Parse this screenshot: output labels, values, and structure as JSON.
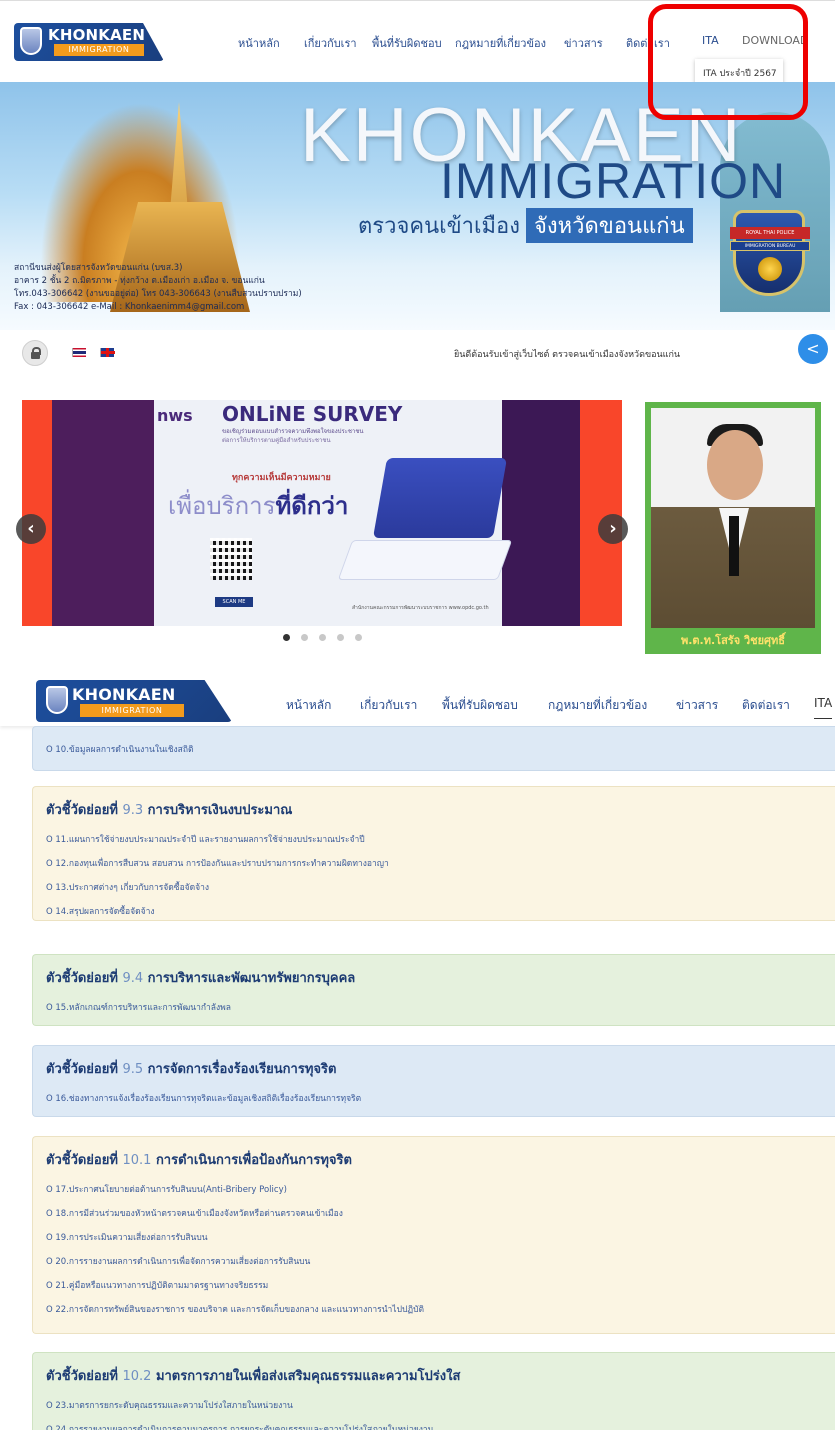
{
  "site": {
    "logo_title": "KHONKAEN",
    "logo_sub": "IMMIGRATION"
  },
  "nav": {
    "items": [
      "หน้าหลัก",
      "เกี่ยวกับเรา",
      "พื้นที่รับผิดชอบ",
      "กฎหมายที่เกี่ยวข้อง",
      "ข่าวสาร",
      "ติดต่อเรา",
      "ITA",
      "DOWNLOAD"
    ],
    "ita_dropdown_item": "ITA ประจำปี 2567"
  },
  "banner": {
    "headline_1": "KHONKAEN",
    "headline_2": "IMMIGRATION",
    "thai_line_a": "ตรวจคนเข้าเมือง",
    "thai_line_b": "จังหวัดขอนแก่น",
    "address": [
      "สถานีขนส่งผู้โดยสารจังหวัดขอนแก่น (บขส.3)",
      "อาคาร 2 ชั้น 2 ถ.มิตรภาพ - ทุ่งกว้าง ต.เมืองเก่า อ.เมือง จ. ขอนแก่น",
      "โทร.043-306642 (งานขออยู่ต่อ) โทร 043-306643 (งานสืบสวนปราบปราม)",
      "Fax : 043-306642 e-Mail : Khonkaenimm4@gmail.com"
    ],
    "badge_line_1": "ROYAL THAI POLICE",
    "badge_line_2": "IMMIGRATION BUREAU"
  },
  "toolbar": {
    "welcome": "ยินดีต้อนรับเข้าสู่เว็บไซต์ ตรวจคนเข้าเมืองจังหวัดขอนแก่น",
    "share_icon": "<"
  },
  "slider": {
    "logo": "nws",
    "title": "ONLiNE SURVEY",
    "sub1": "ขอเชิญร่วมตอบแบบสำรวจความพึงพอใจของประชาชน",
    "sub2": "ต่อการให้บริการตามคู่มือสำหรับประชาชน",
    "claim": "ทุกความเห็นมีความหมาย",
    "big_a": "เพื่อบริการ",
    "big_b": "ที่ดีกว่า",
    "scan": "SCAN ME",
    "credit": "สำนักงานคณะกรรมการพัฒนาระบบราชการ www.opdc.go.th",
    "prev_icon": "‹",
    "next_icon": "›",
    "dot_count": 5,
    "active_dot": 1
  },
  "portrait": {
    "name": "พ.ต.ท.โสรัจ วิชยศุทธิ์"
  },
  "sections": [
    {
      "head_prefix": "",
      "num": "",
      "head_title": "",
      "items": [
        "O 10.ข้อมูลผลการดำเนินงานในเชิงสถิติ"
      ]
    },
    {
      "head_prefix": "ตัวชี้วัดย่อยที่",
      "num": "9.3",
      "head_title": "การบริหารเงินงบประมาณ",
      "items": [
        "O 11.แผนการใช้จ่ายงบประมาณประจำปี และรายงานผลการใช้จ่ายงบประมาณประจำปี",
        "O 12.กองทุนเพื่อการสืบสวน สอบสวน การป้องกันและปราบปรามการกระทำความผิดทางอาญา",
        "O 13.ประกาศต่างๆ เกี่ยวกับการจัดซื้อจัดจ้าง",
        "O 14.สรุปผลการจัดซื้อจัดจ้าง"
      ]
    },
    {
      "head_prefix": "ตัวชี้วัดย่อยที่",
      "num": "9.4",
      "head_title": "การบริหารและพัฒนาทรัพยากรบุคคล",
      "items": [
        "O 15.หลักเกณฑ์การบริหารและการพัฒนากำลังพล"
      ]
    },
    {
      "head_prefix": "ตัวชี้วัดย่อยที่",
      "num": "9.5",
      "head_title": "การจัดการเรื่องร้องเรียนการทุจริต",
      "items": [
        "O 16.ช่องทางการแจ้งเรื่องร้องเรียนการทุจริตและข้อมูลเชิงสถิติเรื่องร้องเรียนการทุจริต"
      ]
    },
    {
      "head_prefix": "ตัวชี้วัดย่อยที่",
      "num": "10.1",
      "head_title": "การดำเนินการเพื่อป้องกันการทุจริต",
      "items": [
        "O 17.ประกาศนโยบายต่อต้านการรับสินบน(Anti-Bribery Policy)",
        "O 18.การมีส่วนร่วมของหัวหน้าตรวจคนเข้าเมืองจังหวัดหรือด่านตรวจคนเข้าเมือง",
        "O 19.การประเมินความเสี่ยงต่อการรับสินบน",
        "O 20.การรายงานผลการดำเนินการเพื่อจัดการความเสี่ยงต่อการรับสินบน",
        "O 21.คู่มือหรือแนวทางการปฏิบัติตามมาตรฐานทางจริยธรรม",
        "O 22.การจัดการทรัพย์สินของราชการ ของบริจาค และการจัดเก็บของกลาง และแนวทางการนำไปปฏิบัติ"
      ]
    },
    {
      "head_prefix": "ตัวชี้วัดย่อยที่",
      "num": "10.2",
      "head_title": "มาตรการภายในเพื่อส่งเสริมคุณธรรมและความโปร่งใส",
      "items": [
        "O 23.มาตรการยกระดับคุณธรรมและความโปร่งใสภายในหน่วยงาน",
        "O 24.การรายงานผลการดำเนินการตามมาตรการ การยกระดับคุณธรรมและความโปร่งใสภายในหน่วยงาน"
      ]
    }
  ]
}
